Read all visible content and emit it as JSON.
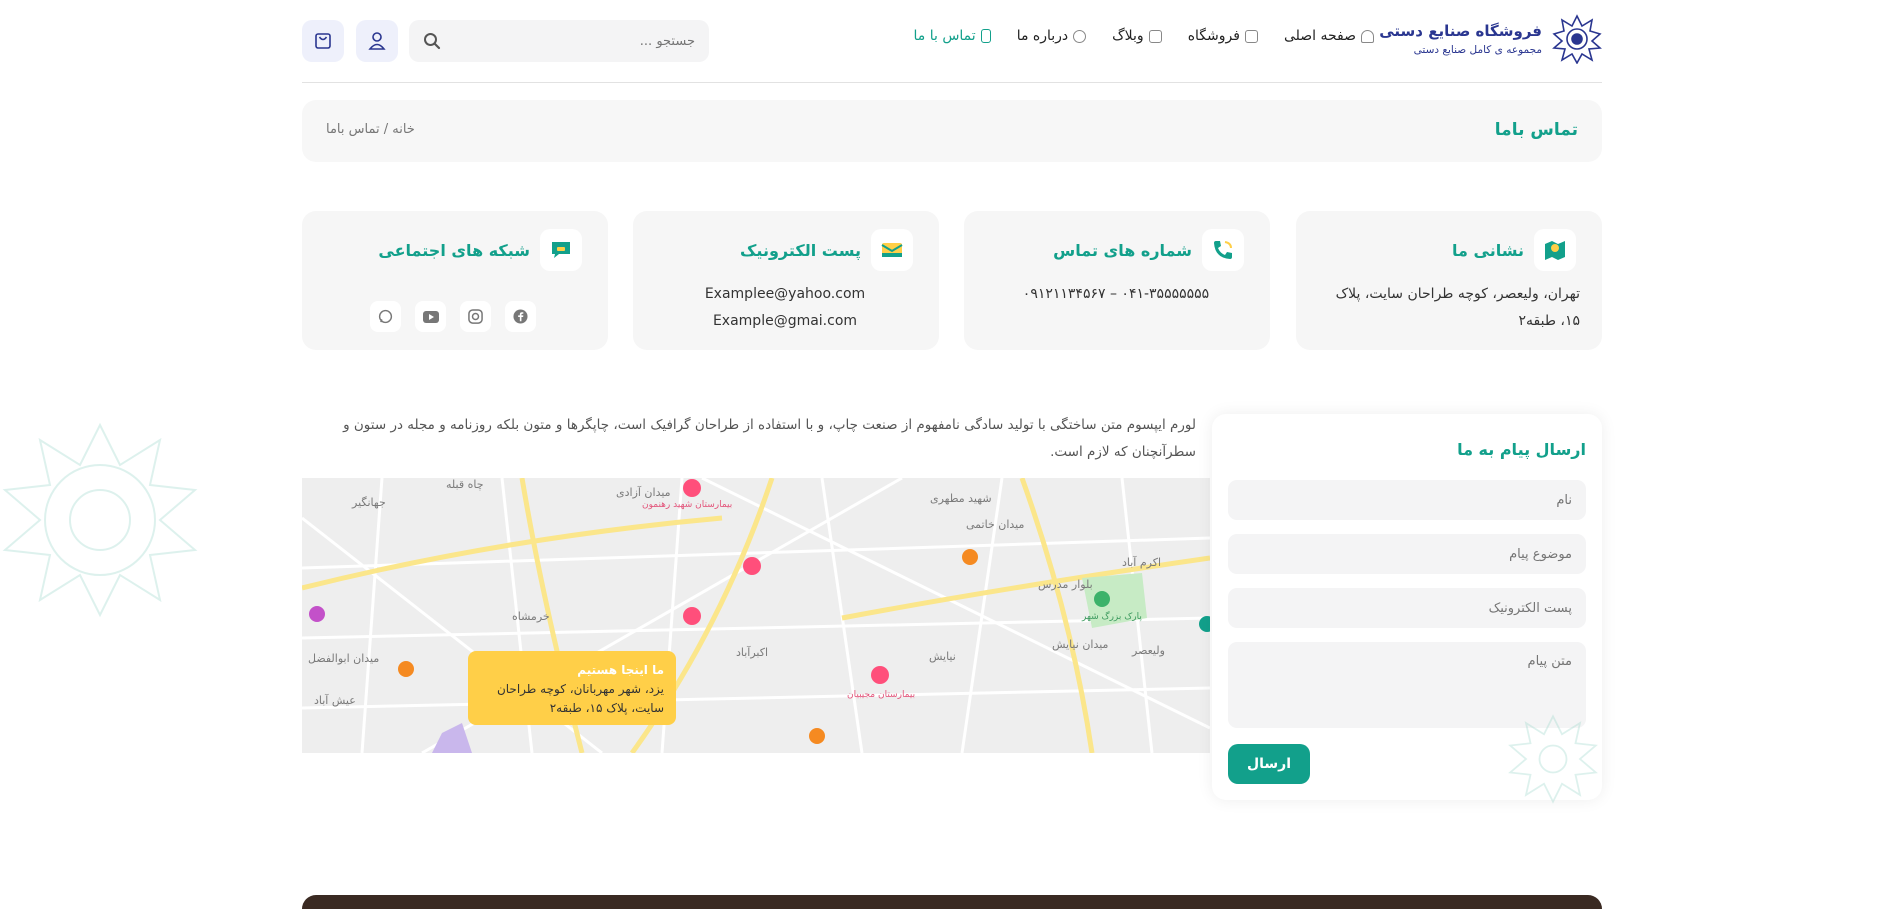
{
  "brand": {
    "title": "فروشگاه صنایع دستی",
    "subtitle": "مجموعه ی کامل صنایع دستی",
    "color": "#2a3690"
  },
  "nav": [
    {
      "label": "صفحه اصلی",
      "icon": "home-icon"
    },
    {
      "label": "فروشگاه",
      "icon": "cart-icon"
    },
    {
      "label": "وبلاگ",
      "icon": "blog-icon"
    },
    {
      "label": "درباره ما",
      "icon": "question-icon"
    },
    {
      "label": "تماس با ما",
      "icon": "phone-icon",
      "active": true
    }
  ],
  "search": {
    "placeholder": "جستجو ..."
  },
  "breadcrumb": {
    "title": "تماس باما",
    "path": "خانه / تماس باما"
  },
  "cards": {
    "address": {
      "title": "نشانی ما",
      "text": "تهران، ولیعصر، کوچه طراحان سایت، پلاک ۱۵، طبقه۲"
    },
    "phones": {
      "title": "شماره های تماس",
      "text": "۰۴۱-۳۵۵۵۵۵۵۵ – ۰۹۱۲۱۱۳۴۵۶۷"
    },
    "email": {
      "title": "پست الکترونیک",
      "line1": "Examplee@yahoo.com",
      "line2": "Example@gmai.com"
    },
    "social": {
      "title": "شبکه های اجتماعی",
      "icons": [
        "facebook-icon",
        "instagram-icon",
        "youtube-icon",
        "whatsapp-icon"
      ]
    }
  },
  "lorem": "لورم ایپسوم متن ساختگی با تولید سادگی نامفهوم از صنعت چاپ، و با استفاده از طراحان گرافیک است، چاپگرها و متون بلکه روزنامه و مجله در ستون و سطرآنچنان که لازم است.",
  "map": {
    "popup_title": "ما اینجا هستیم",
    "popup_text": "یزد، شهر مهربانان، کوچه طراحان سایت، پلاک ۱۵، طبقه۲",
    "labels": [
      "میدان آزادی",
      "شهید مطهری",
      "میدان خاتمی",
      "جهانگیر",
      "اکرم آباد",
      "خرمشاه",
      "بلوار مدرس",
      "ولیعصر",
      "نیایش",
      "میدان نیایش",
      "اکبرآباد",
      "عیش آباد",
      "میدان ابوالفضل",
      "چاه قبله",
      "بیمارستان شهید رهنمون",
      "بیمارستان مجیبیان",
      "پارک بزرگ شهر"
    ]
  },
  "form": {
    "title": "ارسال پیام به ما",
    "name": "نام",
    "subject": "موضوع پیام",
    "email": "پست الکترونیک",
    "message": "متن پیام",
    "submit": "ارسال"
  },
  "colors": {
    "accent": "#12a08b",
    "brand": "#2a3690",
    "popup": "#ffcf48"
  }
}
